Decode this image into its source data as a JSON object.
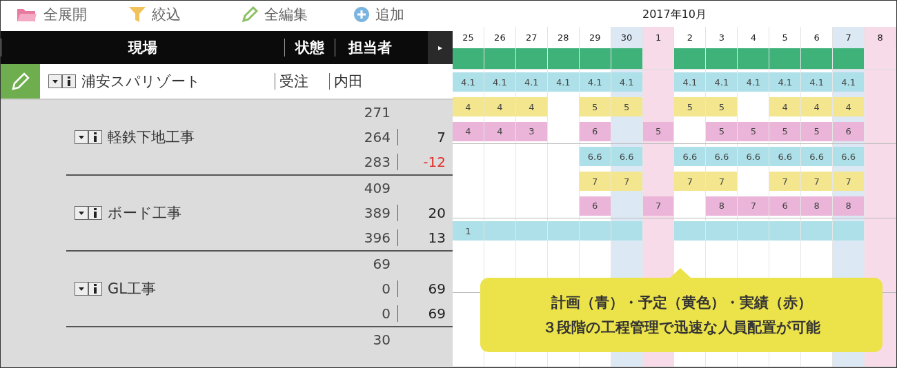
{
  "toolbar": [
    {
      "label": "全展開",
      "kind": "folder",
      "color": "#e8799f"
    },
    {
      "label": "絞込",
      "kind": "filter",
      "color": "#f2c25a"
    },
    {
      "label": "全編集",
      "kind": "pencil",
      "color": "#8cc063"
    },
    {
      "label": "追加",
      "kind": "plus",
      "color": "#7ab4e0"
    }
  ],
  "header": {
    "columns": [
      {
        "label": "現場"
      },
      {
        "label": "状態"
      },
      {
        "label": "担当者"
      }
    ],
    "next_button": "▸"
  },
  "month_title": "2017年10月",
  "days": [
    {
      "label": "25",
      "kind": "weekday"
    },
    {
      "label": "26",
      "kind": "weekday"
    },
    {
      "label": "27",
      "kind": "weekday"
    },
    {
      "label": "28",
      "kind": "weekday"
    },
    {
      "label": "29",
      "kind": "weekday"
    },
    {
      "label": "30",
      "kind": "saturday"
    },
    {
      "label": "1",
      "kind": "sunday"
    },
    {
      "label": "2",
      "kind": "weekday"
    },
    {
      "label": "3",
      "kind": "weekday"
    },
    {
      "label": "4",
      "kind": "weekday"
    },
    {
      "label": "5",
      "kind": "weekday"
    },
    {
      "label": "6",
      "kind": "weekday"
    },
    {
      "label": "7",
      "kind": "saturday"
    },
    {
      "label": "8",
      "kind": "sunday"
    }
  ],
  "project": {
    "name": "浦安スパリゾート",
    "status": "受注",
    "assignee": "内田",
    "schedule": [
      true,
      true,
      true,
      true,
      true,
      true,
      false,
      true,
      true,
      true,
      true,
      true,
      true,
      false
    ]
  },
  "groups": [
    {
      "name": "軽鉄下地工事",
      "lines": [
        {
          "kind": "plan",
          "value": "271",
          "cells": [
            "4.1",
            "4.1",
            "4.1",
            "4.1",
            "4.1",
            "4.1",
            null,
            "4.1",
            "4.1",
            "4.1",
            "4.1",
            "4.1",
            "4.1",
            null
          ]
        },
        {
          "kind": "schedule",
          "value": "264",
          "diff": "7",
          "negative": false,
          "cells": [
            "4",
            "4",
            "4",
            null,
            "5",
            "5",
            null,
            "5",
            "5",
            null,
            "4",
            "4",
            "4",
            null
          ]
        },
        {
          "kind": "actual",
          "value": "283",
          "diff": "-12",
          "negative": true,
          "cells": [
            "4",
            "4",
            "3",
            null,
            "6",
            null,
            "5",
            null,
            "5",
            "5",
            "5",
            "5",
            "6",
            null
          ]
        }
      ]
    },
    {
      "name": "ボード工事",
      "lines": [
        {
          "kind": "plan",
          "value": "409",
          "cells": [
            null,
            null,
            null,
            null,
            "6.6",
            "6.6",
            null,
            "6.6",
            "6.6",
            "6.6",
            "6.6",
            "6.6",
            "6.6",
            null
          ]
        },
        {
          "kind": "schedule",
          "value": "389",
          "diff": "20",
          "negative": false,
          "cells": [
            null,
            null,
            null,
            null,
            "7",
            "7",
            null,
            "7",
            "7",
            null,
            "7",
            "7",
            "7",
            null
          ]
        },
        {
          "kind": "actual",
          "value": "396",
          "diff": "13",
          "negative": false,
          "cells": [
            null,
            null,
            null,
            null,
            "6",
            null,
            "7",
            null,
            "8",
            "7",
            "6",
            "8",
            "8",
            null
          ]
        }
      ]
    },
    {
      "name": "GL工事",
      "lines": [
        {
          "kind": "plan",
          "value": "69",
          "cells": [
            "1",
            true,
            true,
            true,
            true,
            true,
            null,
            true,
            true,
            true,
            true,
            true,
            true,
            null
          ]
        },
        {
          "value": "0",
          "diff": "69",
          "negative": false
        },
        {
          "value": "0",
          "diff": "69",
          "negative": false
        }
      ]
    },
    {
      "lines": [
        {
          "value": "30"
        }
      ]
    }
  ],
  "callout": {
    "lines": [
      "計画（青）・予定（黄色）・実績（赤）",
      "３段階の工程管理で迅速な人員配置が可能"
    ]
  }
}
